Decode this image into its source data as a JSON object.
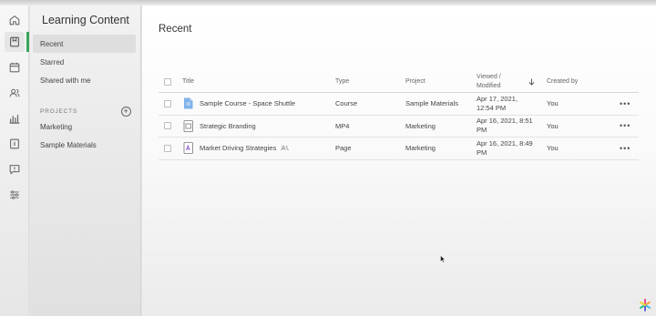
{
  "rail": {
    "items": [
      {
        "icon": "home-icon"
      },
      {
        "icon": "content-icon",
        "active": true
      },
      {
        "icon": "calendar-icon"
      },
      {
        "icon": "users-icon"
      },
      {
        "icon": "analytics-icon"
      },
      {
        "icon": "book-icon"
      },
      {
        "icon": "feedback-icon"
      },
      {
        "icon": "settings-icon"
      }
    ],
    "accent": "#3aa55a"
  },
  "sidebar": {
    "title": "Learning Content",
    "items": [
      {
        "label": "Recent",
        "active": true
      },
      {
        "label": "Starred"
      },
      {
        "label": "Shared with me"
      }
    ],
    "projects_heading": "PROJECTS",
    "projects": [
      {
        "label": "Marketing"
      },
      {
        "label": "Sample Materials"
      }
    ]
  },
  "main": {
    "title": "Recent",
    "columns": {
      "title": "Title",
      "type": "Type",
      "project": "Project",
      "viewed_line1": "Viewed /",
      "viewed_line2": "Modified",
      "created_by": "Created by"
    },
    "rows": [
      {
        "title": "Sample Course - Space Shuttle",
        "icon": "course-icon",
        "shared": false,
        "type": "Course",
        "project": "Sample Materials",
        "date_line1": "Apr 17, 2021,",
        "date_line2": "12:54 PM",
        "created_by": "You",
        "more": "•••"
      },
      {
        "title": "Strategic Branding",
        "icon": "video-file-icon",
        "shared": false,
        "type": "MP4",
        "project": "Marketing",
        "date_line1": "Apr 16, 2021, 8:51",
        "date_line2": "PM",
        "created_by": "You",
        "more": "•••"
      },
      {
        "title": "Market Driving Strategies",
        "icon": "page-file-icon",
        "shared": true,
        "type": "Page",
        "project": "Marketing",
        "date_line1": "Apr 16, 2021, 8:49",
        "date_line2": "PM",
        "created_by": "You",
        "more": "•••"
      }
    ]
  }
}
